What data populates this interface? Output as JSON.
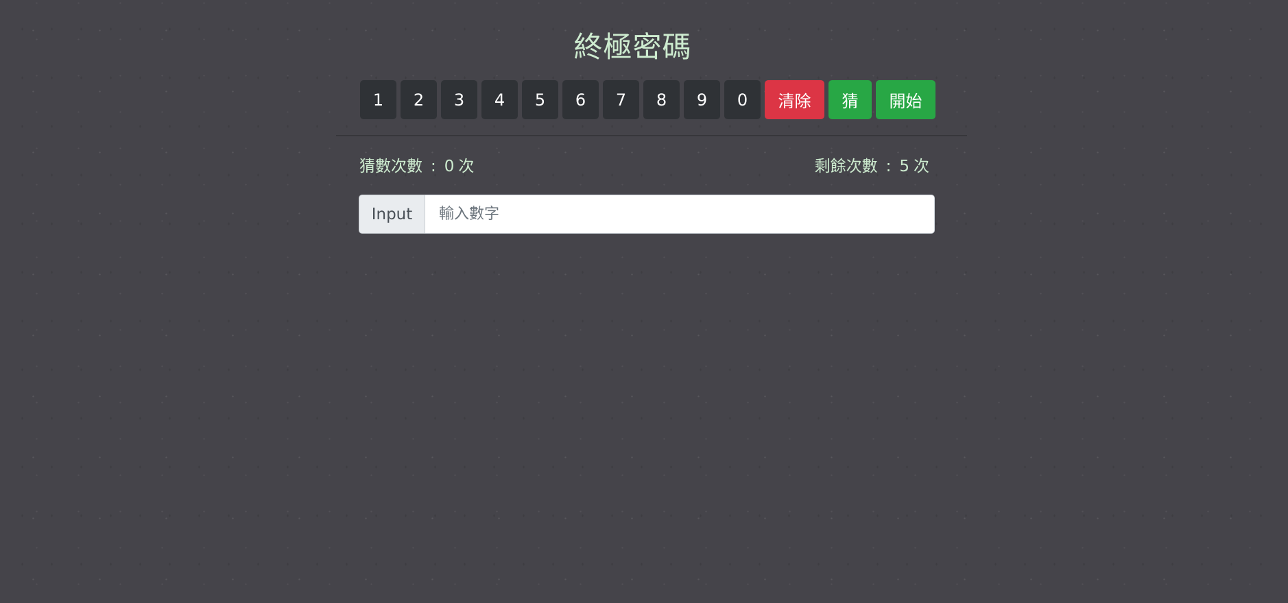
{
  "title": "終極密碼",
  "keypad": {
    "digits": [
      "1",
      "2",
      "3",
      "4",
      "5",
      "6",
      "7",
      "8",
      "9",
      "0"
    ],
    "clear_label": "清除",
    "guess_label": "猜",
    "start_label": "開始"
  },
  "stats": {
    "guess_count_label": "猜數次數",
    "guess_count_value": "0",
    "remaining_label": "剩餘次數",
    "remaining_value": "5",
    "separator": ":",
    "unit": "次"
  },
  "input": {
    "label": "Input",
    "placeholder": "輸入數字",
    "value": ""
  },
  "colors": {
    "background": "#45444a",
    "title_text": "#cdebcf",
    "digit_button": "#2f3236",
    "clear_button": "#dc3545",
    "action_button": "#28a745"
  }
}
